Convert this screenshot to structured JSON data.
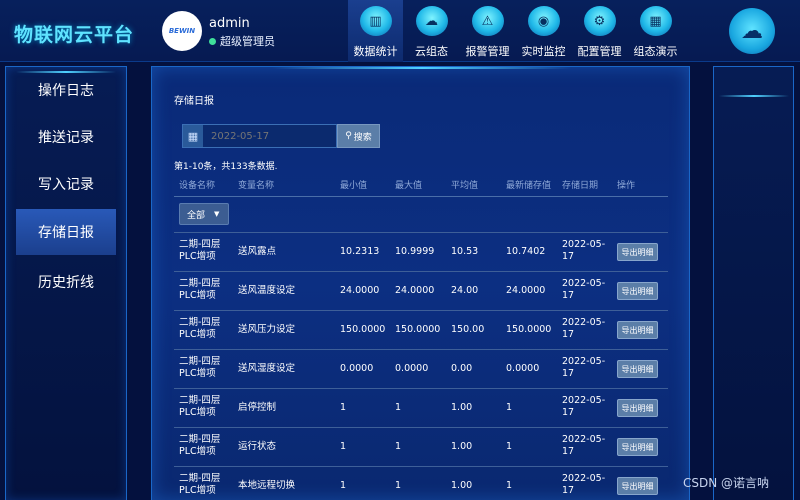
{
  "header": {
    "brand": "物联网云平台",
    "avatar_text": "BEWIN",
    "user_name": "admin",
    "user_role": "超级管理员",
    "nav": [
      {
        "label": "数据统计",
        "icon": "chart-icon",
        "active": true
      },
      {
        "label": "云组态",
        "icon": "cloud-icon",
        "active": false
      },
      {
        "label": "报警管理",
        "icon": "alarm-icon",
        "active": false
      },
      {
        "label": "实时监控",
        "icon": "monitor-icon",
        "active": false
      },
      {
        "label": "配置管理",
        "icon": "gear-icon",
        "active": false
      },
      {
        "label": "组态演示",
        "icon": "building-icon",
        "active": false
      }
    ]
  },
  "sidebar": {
    "items": [
      {
        "label": "操作日志",
        "active": false
      },
      {
        "label": "推送记录",
        "active": false
      },
      {
        "label": "写入记录",
        "active": false
      },
      {
        "label": "存储日报",
        "active": true
      },
      {
        "label": "历史折线",
        "active": false
      }
    ]
  },
  "main": {
    "title": "存储日报",
    "date_placeholder": "2022-05-17",
    "search_label": "搜索",
    "summary": "第1-10条，共133条数据.",
    "columns": [
      "设备名称",
      "变量名称",
      "最小值",
      "最大值",
      "平均值",
      "最新储存值",
      "存储日期",
      "操作"
    ],
    "filter_value": "全部",
    "rows": [
      {
        "device": "二期-四层PLC增项",
        "variable": "送风露点",
        "min": "10.2313",
        "max": "10.9999",
        "avg": "10.53",
        "latest": "10.7402",
        "date": "2022-05-17",
        "action": "导出明细"
      },
      {
        "device": "二期-四层PLC增项",
        "variable": "送风温度设定",
        "min": "24.0000",
        "max": "24.0000",
        "avg": "24.00",
        "latest": "24.0000",
        "date": "2022-05-17",
        "action": "导出明细"
      },
      {
        "device": "二期-四层PLC增项",
        "variable": "送风压力设定",
        "min": "150.0000",
        "max": "150.0000",
        "avg": "150.00",
        "latest": "150.0000",
        "date": "2022-05-17",
        "action": "导出明细"
      },
      {
        "device": "二期-四层PLC增项",
        "variable": "送风湿度设定",
        "min": "0.0000",
        "max": "0.0000",
        "avg": "0.00",
        "latest": "0.0000",
        "date": "2022-05-17",
        "action": "导出明细"
      },
      {
        "device": "二期-四层PLC增项",
        "variable": "启停控制",
        "min": "1",
        "max": "1",
        "avg": "1.00",
        "latest": "1",
        "date": "2022-05-17",
        "action": "导出明细"
      },
      {
        "device": "二期-四层PLC增项",
        "variable": "运行状态",
        "min": "1",
        "max": "1",
        "avg": "1.00",
        "latest": "1",
        "date": "2022-05-17",
        "action": "导出明细"
      },
      {
        "device": "二期-四层PLC增项",
        "variable": "本地远程切换",
        "min": "1",
        "max": "1",
        "avg": "1.00",
        "latest": "1",
        "date": "2022-05-17",
        "action": "导出明细"
      }
    ]
  },
  "watermark": "CSDN @诺言呐",
  "colors": {
    "accent": "#5fe3ff",
    "panel_border": "#1a67c8",
    "button": "#5b7ea8",
    "online": "#3fe09a"
  }
}
